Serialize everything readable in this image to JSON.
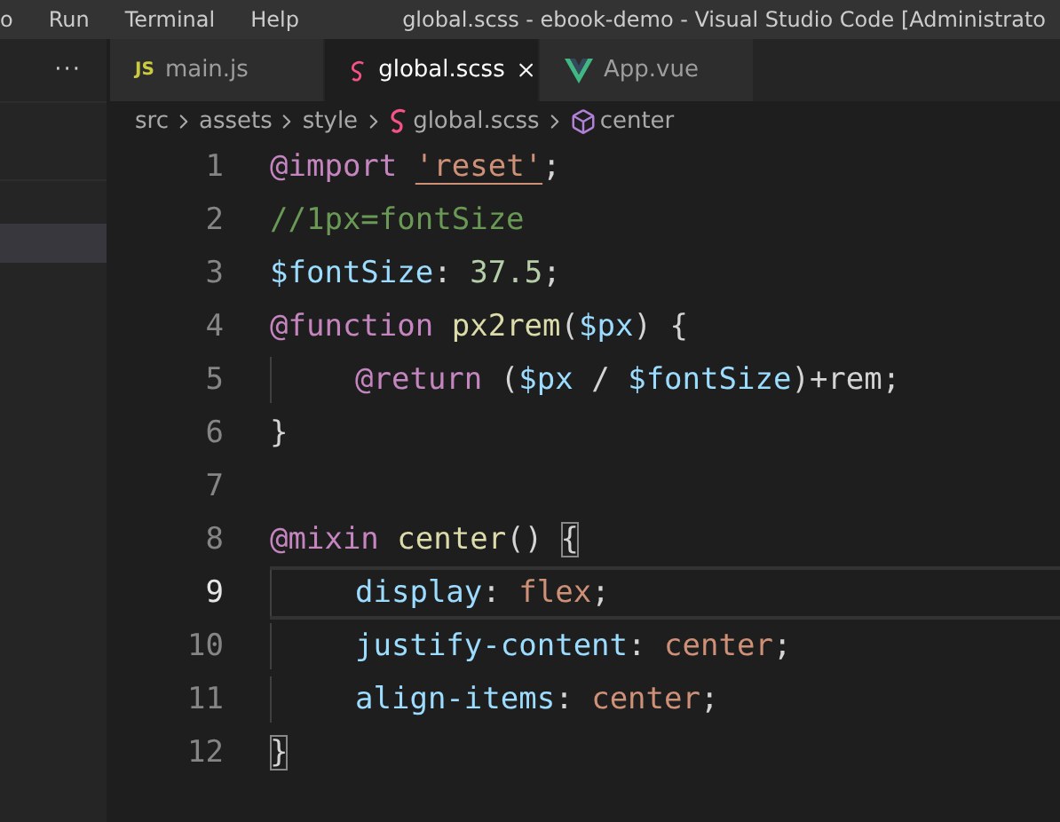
{
  "menu": [
    "o",
    "Run",
    "Terminal",
    "Help"
  ],
  "window": {
    "title": "global.scss - ebook-demo - Visual Studio Code [Administrato"
  },
  "sidebar": {
    "more": "···"
  },
  "tabs": [
    {
      "label": "main.js",
      "icon": "JS",
      "kind": "js",
      "selected": false
    },
    {
      "label": "global.scss",
      "kind": "scss",
      "selected": true
    },
    {
      "label": "App.vue",
      "kind": "vue",
      "selected": false
    }
  ],
  "breadcrumbs": [
    {
      "label": "src",
      "kind": "folder"
    },
    {
      "label": "assets",
      "kind": "folder"
    },
    {
      "label": "style",
      "kind": "folder"
    },
    {
      "label": "global.scss",
      "kind": "scss"
    },
    {
      "label": "center",
      "kind": "mixin"
    }
  ],
  "lines": [
    {
      "number": "1",
      "indent": false,
      "current": false,
      "tokens": [
        {
          "kind": "keyword",
          "text": "@import "
        },
        {
          "kind": "link-string",
          "text": "'reset'"
        },
        {
          "kind": "plain",
          "text": ";"
        }
      ]
    },
    {
      "number": "2",
      "indent": false,
      "current": false,
      "tokens": [
        {
          "kind": "comment",
          "text": "//1px=fontSize"
        }
      ]
    },
    {
      "number": "3",
      "indent": false,
      "current": false,
      "tokens": [
        {
          "kind": "variable",
          "text": "$fontSize"
        },
        {
          "kind": "plain",
          "text": ": "
        },
        {
          "kind": "number",
          "text": "37.5"
        },
        {
          "kind": "plain",
          "text": ";"
        }
      ]
    },
    {
      "number": "4",
      "indent": false,
      "current": false,
      "tokens": [
        {
          "kind": "keyword",
          "text": "@function "
        },
        {
          "kind": "function",
          "text": "px2rem"
        },
        {
          "kind": "plain",
          "text": "("
        },
        {
          "kind": "variable",
          "text": "$px"
        },
        {
          "kind": "plain",
          "text": ") {"
        }
      ]
    },
    {
      "number": "5",
      "indent": true,
      "current": false,
      "tokens": [
        {
          "kind": "keyword",
          "text": "@return"
        },
        {
          "kind": "plain",
          "text": " ("
        },
        {
          "kind": "variable",
          "text": "$px"
        },
        {
          "kind": "plain",
          "text": " / "
        },
        {
          "kind": "variable",
          "text": "$fontSize"
        },
        {
          "kind": "plain",
          "text": ")+rem;"
        }
      ]
    },
    {
      "number": "6",
      "indent": false,
      "current": false,
      "tokens": [
        {
          "kind": "plain",
          "text": "}"
        }
      ]
    },
    {
      "number": "7",
      "current": false
    },
    {
      "number": "8",
      "indent": false,
      "current": false,
      "tokens": [
        {
          "kind": "keyword",
          "text": "@mixin "
        },
        {
          "kind": "function",
          "text": "center"
        },
        {
          "kind": "plain",
          "text": "() "
        },
        {
          "kind": "bracket-match",
          "text": "{"
        }
      ]
    },
    {
      "number": "9",
      "indent": true,
      "current": true,
      "tokens": [
        {
          "kind": "property",
          "text": "display"
        },
        {
          "kind": "plain",
          "text": ": "
        },
        {
          "kind": "value",
          "text": "flex"
        },
        {
          "kind": "plain",
          "text": ";"
        }
      ]
    },
    {
      "number": "10",
      "indent": true,
      "current": false,
      "tokens": [
        {
          "kind": "property",
          "text": "justify-content"
        },
        {
          "kind": "plain",
          "text": ": "
        },
        {
          "kind": "value",
          "text": "center"
        },
        {
          "kind": "plain",
          "text": ";"
        }
      ]
    },
    {
      "number": "11",
      "indent": true,
      "current": false,
      "tokens": [
        {
          "kind": "property",
          "text": "align-items"
        },
        {
          "kind": "plain",
          "text": ": "
        },
        {
          "kind": "value",
          "text": "center"
        },
        {
          "kind": "plain",
          "text": ";"
        }
      ]
    },
    {
      "number": "12",
      "indent": false,
      "current": false,
      "tokens": [
        {
          "kind": "bracket-match",
          "text": "}"
        }
      ]
    }
  ]
}
